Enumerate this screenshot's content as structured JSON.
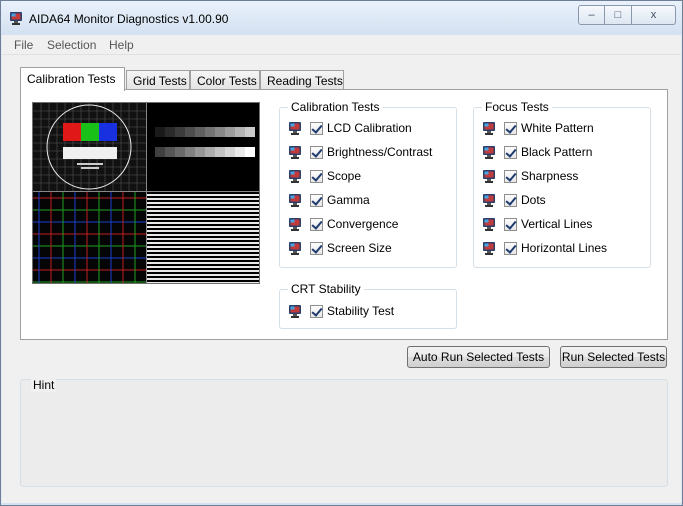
{
  "window": {
    "title": "AIDA64 Monitor Diagnostics v1.00.90",
    "minimize_glyph": "–",
    "maximize_glyph": "□",
    "close_glyph": "x"
  },
  "menu": {
    "items": [
      "File",
      "Selection",
      "Help"
    ]
  },
  "tabs": [
    {
      "label": "Calibration Tests",
      "active": true
    },
    {
      "label": "Grid Tests",
      "active": false
    },
    {
      "label": "Color Tests",
      "active": false
    },
    {
      "label": "Reading Tests",
      "active": false
    }
  ],
  "groups": {
    "calibration": {
      "title": "Calibration Tests",
      "items": [
        {
          "label": "LCD Calibration",
          "checked": true
        },
        {
          "label": "Brightness/Contrast",
          "checked": true
        },
        {
          "label": "Scope",
          "checked": true
        },
        {
          "label": "Gamma",
          "checked": true
        },
        {
          "label": "Convergence",
          "checked": true
        },
        {
          "label": "Screen Size",
          "checked": true
        }
      ]
    },
    "focus": {
      "title": "Focus Tests",
      "items": [
        {
          "label": "White Pattern",
          "checked": true
        },
        {
          "label": "Black Pattern",
          "checked": true
        },
        {
          "label": "Sharpness",
          "checked": true
        },
        {
          "label": "Dots",
          "checked": true
        },
        {
          "label": "Vertical Lines",
          "checked": true
        },
        {
          "label": "Horizontal Lines",
          "checked": true
        }
      ]
    },
    "crt": {
      "title": "CRT Stability",
      "items": [
        {
          "label": "Stability Test",
          "checked": true
        }
      ]
    }
  },
  "buttons": {
    "auto_run": "Auto Run Selected Tests",
    "run": "Run Selected Tests"
  },
  "hint": {
    "title": "Hint"
  },
  "icons": {
    "test_item": "monitor-icon",
    "app": "monitor-icon"
  }
}
